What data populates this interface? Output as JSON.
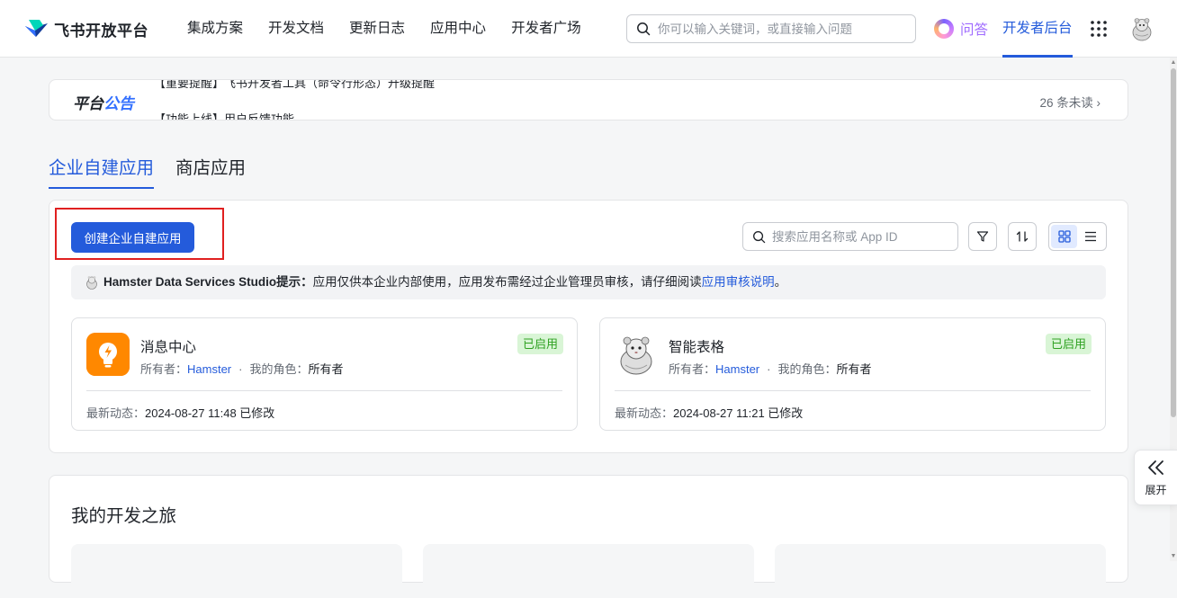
{
  "brand": {
    "name": "飞书开放平台"
  },
  "nav": {
    "items": [
      {
        "label": "集成方案"
      },
      {
        "label": "开发文档"
      },
      {
        "label": "更新日志"
      },
      {
        "label": "应用中心"
      },
      {
        "label": "开发者广场"
      }
    ],
    "search_placeholder": "你可以输入关键词，或直接输入问题",
    "ask_label": "问答",
    "dev_console_label": "开发者后台"
  },
  "notice": {
    "title_part1": "平台",
    "title_part2": "公告",
    "ticker_line1": "【重要提醒】飞书开发者工具（命令行形态）升级提醒",
    "ticker_line2": "【功能上线】用户反馈功能",
    "unread": "26 条未读",
    "unread_chevron": "›"
  },
  "tabs": [
    {
      "label": "企业自建应用",
      "active": true
    },
    {
      "label": "商店应用",
      "active": false
    }
  ],
  "toolbar": {
    "create_label": "创建企业自建应用",
    "search_placeholder": "搜索应用名称或 App ID"
  },
  "tip": {
    "org": "Hamster Data Services Studio提示：",
    "text": "应用仅供本企业内部使用，应用发布需经过企业管理员审核，请仔细阅读 ",
    "link": "应用审核说明",
    "end": "。"
  },
  "apps": [
    {
      "name": "消息中心",
      "owner_label": "所有者：",
      "owner": "Hamster",
      "dot": "·",
      "role_label": "我的角色：",
      "role": "所有者",
      "status": "已启用",
      "updated_label": "最新动态：",
      "updated": "2024-08-27 11:48 已修改",
      "icon": "lightbulb-icon",
      "icon_color": "#ff8800"
    },
    {
      "name": "智能表格",
      "owner_label": "所有者：",
      "owner": "Hamster",
      "dot": "·",
      "role_label": "我的角色：",
      "role": "所有者",
      "status": "已启用",
      "updated_label": "最新动态：",
      "updated": "2024-08-27 11:21 已修改",
      "icon": "hamster-icon"
    }
  ],
  "journey": {
    "title": "我的开发之旅"
  },
  "expand": {
    "label": "展开"
  },
  "colors": {
    "primary": "#245bdb",
    "success_bg": "#d9f5d6",
    "success_text": "#2ea121",
    "highlight": "#e02020"
  }
}
